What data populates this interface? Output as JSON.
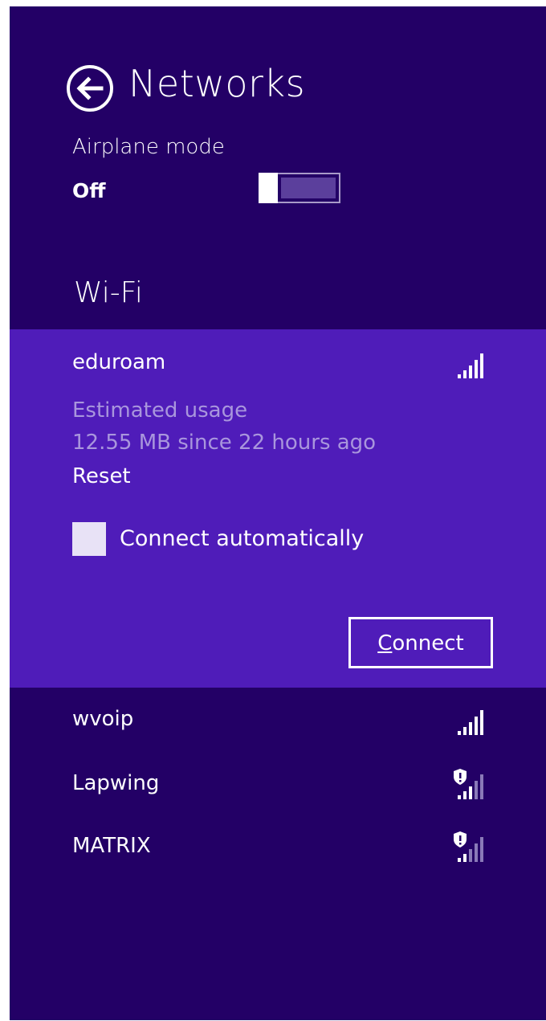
{
  "header": {
    "title": "Networks",
    "back_icon": "back-arrow-icon"
  },
  "airplane": {
    "label": "Airplane mode",
    "state": "Off",
    "on": false
  },
  "wifi": {
    "heading": "Wi-Fi",
    "selected": {
      "name": "eduroam",
      "secured": false,
      "usage_label": "Estimated usage",
      "usage_value": "12.55 MB since 22 hours ago",
      "reset_label": "Reset",
      "auto_connect_label": "Connect automatically",
      "auto_connect_checked": false,
      "connect_label_underlined": "C",
      "connect_label_rest": "onnect"
    },
    "networks": [
      {
        "name": "wvoip",
        "secured": false,
        "bars": 5
      },
      {
        "name": "Lapwing",
        "secured": true,
        "bars": 3
      },
      {
        "name": "MATRIX",
        "secured": true,
        "bars": 2
      }
    ]
  },
  "colors": {
    "panel_bg": "#230066",
    "selected_bg": "#4f1cb9",
    "muted_text": "#a996dd",
    "text": "#ffffff"
  }
}
